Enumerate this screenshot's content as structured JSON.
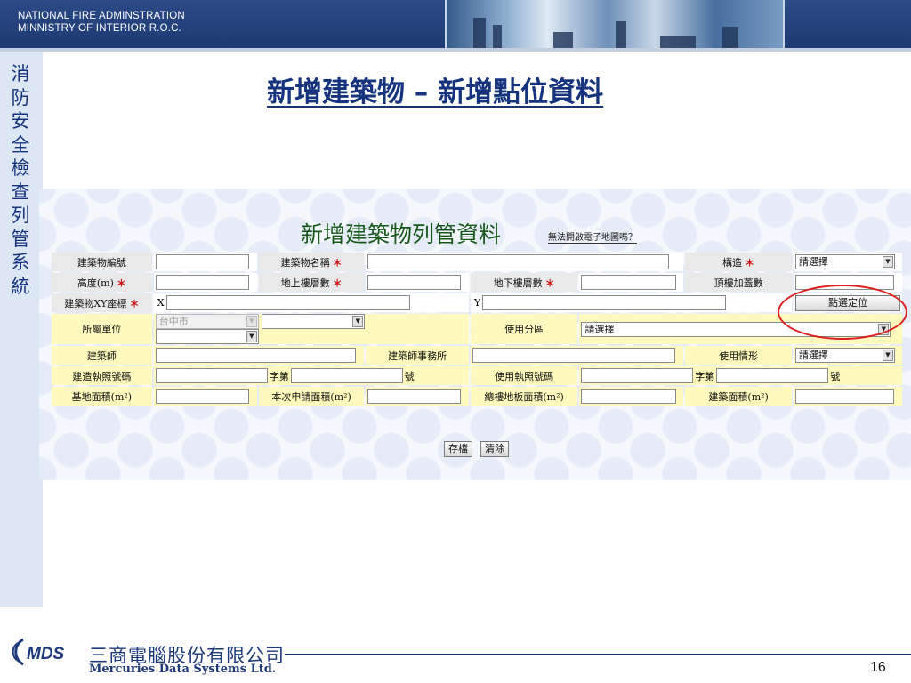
{
  "header": {
    "line1": "NATIONAL FIRE ADMINSTRATION",
    "line2": "MINNISTRY OF INTERIOR R.O.C."
  },
  "sidebar": {
    "title": "消防安全檢查列管系統"
  },
  "slide": {
    "title": "新增建築物 – 新增點位資料",
    "page_number": "16"
  },
  "form": {
    "title": "新增建築物列管資料",
    "map_link": "無法開啟電子地圖嗎？",
    "required_mark": "＊",
    "labels": {
      "building_no": "建築物編號",
      "building_name": "建築物名稱",
      "structure": "構造",
      "height": "高度(m)",
      "floors_above": "地上樓層數",
      "floors_below": "地下樓層數",
      "roof_floors": "頂樓加蓋數",
      "xy": "建築物XY座標",
      "x_prefix": "X",
      "y_prefix": "Y",
      "unit": "所屬單位",
      "zoning": "使用分區",
      "architect": "建築師",
      "architect_office": "建築師事務所",
      "usage": "使用情形",
      "build_permit": "建造執照號碼",
      "use_permit": "使用執照號碼",
      "zi_di": "字第",
      "hao": "號",
      "site_area": "基地面積(m²)",
      "apply_area": "本次申請面積(m²)",
      "total_floor_area": "總樓地板面積(m²)",
      "building_area": "建築面積(m²)"
    },
    "values": {
      "structure": "請選擇",
      "unit_city": "台中市",
      "unit_2": "",
      "unit_3": "",
      "zoning": "請選擇",
      "usage": "請選擇"
    },
    "buttons": {
      "pick_location": "點選定位",
      "save": "存檔",
      "clear": "清除"
    }
  },
  "logo": {
    "brand": "MDS",
    "cn": "三商電腦股份有限公司",
    "en": "Mercuries Data Systems Ltd."
  },
  "colors": {
    "header_bg": "#1d3a74",
    "title": "#16337d",
    "form_title": "#18571c",
    "highlight_circle": "#dd1f1f",
    "label_yellow": "#fff9bd",
    "label_gray": "#e9e9e9"
  }
}
